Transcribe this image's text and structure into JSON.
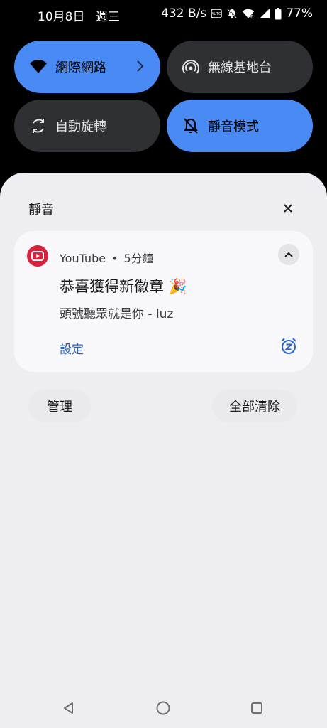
{
  "status_bar": {
    "date": "10月8日",
    "weekday": "週三",
    "net_speed": "432 B/s",
    "battery": "77%"
  },
  "tiles": [
    {
      "label": "網際網路",
      "icon": "wifi-icon",
      "state": "active"
    },
    {
      "label": "無線基地台",
      "icon": "hotspot-icon",
      "state": "inactive"
    },
    {
      "label": "自動旋轉",
      "icon": "rotate-icon",
      "state": "inactive"
    },
    {
      "label": "靜音模式",
      "icon": "bell-off-icon",
      "state": "active"
    }
  ],
  "panel": {
    "header": "靜音",
    "notification": {
      "app_name": "YouTube",
      "separator": "•",
      "time": "5分鐘",
      "title": "恭喜獲得新徽章 🎉",
      "body": "頭號聽眾就是你 - luz",
      "action": "設定"
    },
    "manage_label": "管理",
    "clear_all_label": "全部清除"
  },
  "colors": {
    "accent": "#4a8af4",
    "tile_inactive": "#2f3033",
    "panel_bg": "#eeeef2",
    "card_bg": "#f8f8fb",
    "youtube_red": "#d9213b",
    "link_blue": "#2a63c4"
  }
}
